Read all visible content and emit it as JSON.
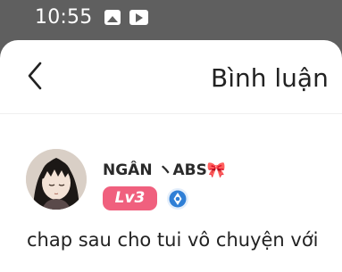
{
  "status_bar": {
    "time": "10:55",
    "icons": [
      "gallery-icon",
      "video-player-icon"
    ]
  },
  "header": {
    "title": "Bình luận",
    "back_icon": "back-arrow-icon"
  },
  "comment": {
    "username": "NGÂN ヽABS🎀",
    "level": "Lv3",
    "badge_icon": "verified-badge-icon",
    "text": "chap sau cho tui vô chuyện với"
  },
  "colors": {
    "level_badge": "#f0607e",
    "verified_badge": "#2f7fd6",
    "overlay": "#5f5f5f"
  }
}
